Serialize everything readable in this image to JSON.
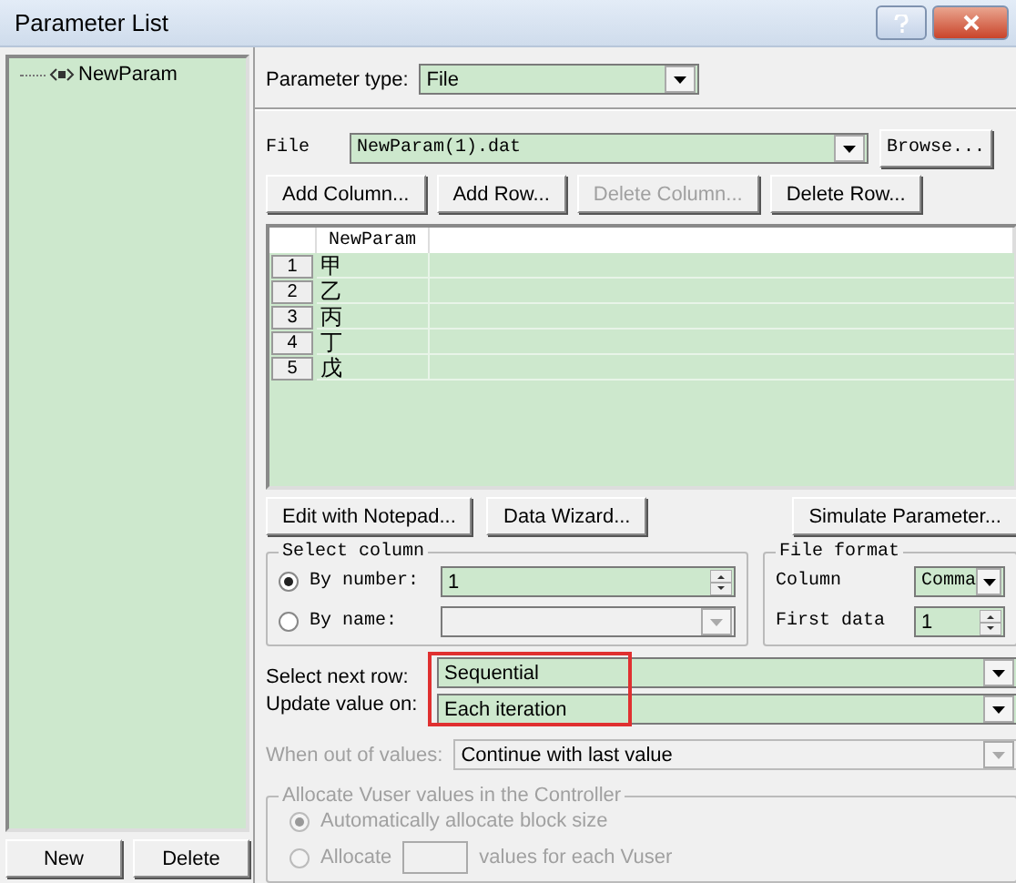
{
  "window": {
    "title": "Parameter List"
  },
  "tree": {
    "items": [
      {
        "label": "NewParam"
      }
    ]
  },
  "left_buttons": [
    "New",
    "Delete"
  ],
  "parameter_type": {
    "label": "Parameter type:",
    "value": "File"
  },
  "file": {
    "label": "File",
    "value": "NewParam(1).dat",
    "browse": "Browse..."
  },
  "table_buttons": [
    {
      "label": "Add Column...",
      "disabled": false
    },
    {
      "label": "Add Row...",
      "disabled": false
    },
    {
      "label": "Delete Column...",
      "disabled": true
    },
    {
      "label": "Delete Row...",
      "disabled": false
    }
  ],
  "table": {
    "columns": [
      "NewParam"
    ],
    "rows": [
      {
        "number": "1",
        "value": "甲"
      },
      {
        "number": "2",
        "value": "乙"
      },
      {
        "number": "3",
        "value": "丙"
      },
      {
        "number": "4",
        "value": "丁"
      },
      {
        "number": "5",
        "value": "戊"
      }
    ]
  },
  "action_buttons": [
    "Edit with Notepad...",
    "Data Wizard...",
    "Simulate Parameter..."
  ],
  "select_column": {
    "title": "Select column",
    "options": [
      {
        "label": "By number:",
        "selected": true,
        "value": "1"
      },
      {
        "label": "By name:",
        "selected": false
      }
    ]
  },
  "file_format": {
    "title": "File format",
    "column": {
      "label": "Column",
      "value": "Comma"
    },
    "first_data": {
      "label": "First data",
      "value": "1"
    }
  },
  "select_next_row": {
    "label": "Select next row:",
    "value": "Sequential"
  },
  "update_value_on": {
    "label": "Update value on:",
    "value": "Each iteration"
  },
  "out_of_values": {
    "label": "When out of values:",
    "value": "Continue with last value",
    "disabled": true
  },
  "allocate": {
    "title": "Allocate Vuser values in the Controller",
    "disabled": true,
    "options": [
      {
        "label": "Automatically allocate block size",
        "selected": true
      },
      {
        "label": "Allocate",
        "suffix": "values for each Vuser",
        "selected": false
      }
    ]
  }
}
